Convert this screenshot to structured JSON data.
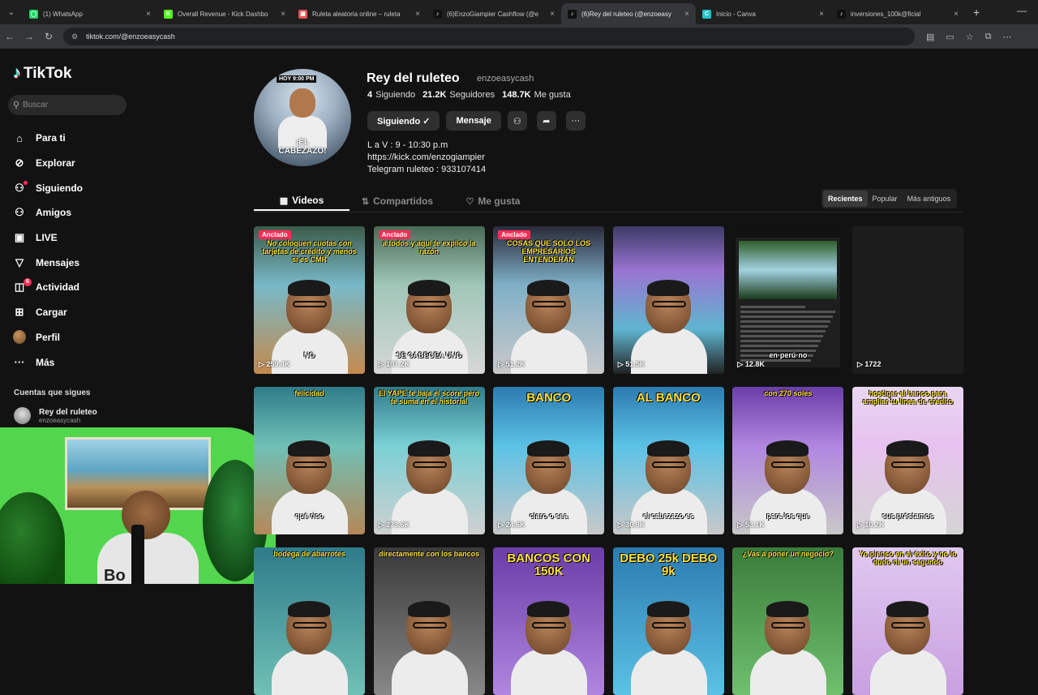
{
  "browser": {
    "tabs": [
      {
        "title": "(1) WhatsApp",
        "fav_color": "#25d366",
        "fav_glyph": "◯"
      },
      {
        "title": "Overall Revenue - Kick Dashbo",
        "fav_color": "#53fc18",
        "fav_glyph": "K"
      },
      {
        "title": "Ruleta aleatoria online – ruleta",
        "fav_color": "#e94f4f",
        "fav_glyph": "▦"
      },
      {
        "title": "(6)EnzoGiampier Cashflow (@e",
        "fav_color": "#111111",
        "fav_glyph": "♪"
      },
      {
        "title": "(6)Rey del ruleteo (@enzoeasy",
        "fav_color": "#111111",
        "fav_glyph": "♪",
        "active": true
      },
      {
        "title": "Inicio - Canva",
        "fav_color": "#20c4cb",
        "fav_glyph": "C"
      },
      {
        "title": "inversiones_100k@ficial",
        "fav_color": "#111111",
        "fav_glyph": "♪"
      }
    ],
    "url": "tiktok.com/@enzoeasycash"
  },
  "sidebar": {
    "logo": "TikTok",
    "search_placeholder": "Buscar",
    "items": [
      {
        "label": "Para ti",
        "icon": "home-icon",
        "glyph": "⌂"
      },
      {
        "label": "Explorar",
        "icon": "compass-icon",
        "glyph": "⊘"
      },
      {
        "label": "Siguiendo",
        "icon": "following-icon",
        "glyph": "⚇"
      },
      {
        "label": "Amigos",
        "icon": "friends-icon",
        "glyph": "⚇"
      },
      {
        "label": "LIVE",
        "icon": "live-icon",
        "glyph": "▣"
      },
      {
        "label": "Mensajes",
        "icon": "messages-icon",
        "glyph": "▽"
      },
      {
        "label": "Actividad",
        "icon": "activity-icon",
        "glyph": "◫",
        "badge": "6"
      },
      {
        "label": "Cargar",
        "icon": "upload-icon",
        "glyph": "⊞"
      },
      {
        "label": "Perfil",
        "icon": "profile-avatar-icon",
        "glyph": ""
      },
      {
        "label": "Más",
        "icon": "more-icon",
        "glyph": "···"
      }
    ],
    "following_title": "Cuentas que sigues",
    "following": [
      {
        "name": "Rey del ruleteo",
        "handle": "enzoeasycash"
      }
    ]
  },
  "profile": {
    "avatar_top": "HOY 9:00 PM",
    "avatar_caption": "¡EL CABEZAZO!",
    "name": "Rey del ruleteo",
    "handle": "enzoeasycash",
    "stats": [
      {
        "value": "4",
        "label": "Siguiendo"
      },
      {
        "value": "21.2K",
        "label": "Seguidores"
      },
      {
        "value": "148.7K",
        "label": "Me gusta"
      }
    ],
    "buttons": {
      "following": "Siguiendo ✓",
      "message": "Mensaje"
    },
    "bio": [
      "L a V : 9 - 10:30 p.m",
      "https://kick.com/enzogiampier",
      "Telegram ruleteo : 933107414"
    ]
  },
  "tabs": [
    {
      "label": "Videos",
      "icon": "▦",
      "active": true
    },
    {
      "label": "Compartidos",
      "icon": "⇅"
    },
    {
      "label": "Me gusta",
      "icon": "♡"
    }
  ],
  "sort": [
    "Recientes",
    "Popular",
    "Más antiguos"
  ],
  "webcam_watermark": "Bo",
  "videos": [
    {
      "views": "259.4K",
      "pinned": "Anclado",
      "caption": "No coloquen cuotas con tarjetas de crédito y menos si es CMR",
      "cap_color": "yellow",
      "sub": "NO",
      "bg": "linear-gradient(180deg,#3b5b4a,#78b9c8 40%,#c48a4d 100%)"
    },
    {
      "views": "107.2K",
      "pinned": "Anclado",
      "caption": "a todos y aquí te explico la razón",
      "cap_color": "yellow",
      "sub": "SE CABECEA UNO",
      "bg": "linear-gradient(180deg,#4a6a55,#9fc7b8 40%,#d7d7d7 100%)"
    },
    {
      "views": "51.2K",
      "pinned": "Anclado",
      "caption": "COSAS QUE SOLO LOS EMPRESARIOS ENTENDERÁN",
      "cap_color": "yellow",
      "sub": "",
      "bg": "linear-gradient(180deg,#2a2a3a,#7fb0c8 40%,#c9c9c9 100%)"
    },
    {
      "views": "51.5K",
      "pinned": "",
      "caption": "",
      "cap_color": "yellow",
      "sub": "",
      "bg": "linear-gradient(180deg,#3b3b66,#9a74d1 30%,#5fb5d0 70%,#222 100%)"
    },
    {
      "views": "12.8K",
      "pinned": "",
      "caption": "",
      "cap_color": "yellow",
      "sub": "en·perú·no",
      "bg": "#111",
      "doc": true
    },
    {
      "views": "1722",
      "pinned": "",
      "caption": "",
      "cap_color": "yellow",
      "sub": "",
      "bg": "#1c1c1c",
      "empty": true
    },
    {
      "views": "",
      "pinned": "",
      "caption": "felicidad",
      "cap_color": "yellow",
      "sub": "qué rico",
      "bg": "linear-gradient(180deg,#2f7c8a,#6fc0b5 40%,#b58858 100%)"
    },
    {
      "views": "273.6K",
      "pinned": "",
      "caption": "El YAPE te baja el score pero te suma en el historial",
      "cap_color": "yellow",
      "sub": "",
      "bg": "linear-gradient(180deg,#2f7c8a,#7ad0d5 40%,#d0d0d0 100%)"
    },
    {
      "views": "24.6K",
      "pinned": "",
      "caption": "BANCO",
      "cap_color": "yellow",
      "sub": "claro o sea",
      "bg": "linear-gradient(180deg,#2c7bb0,#5bc2e5 40%,#c8c8c8 100%)",
      "big": true
    },
    {
      "views": "30.9K",
      "pinned": "",
      "caption": "AL BANCO",
      "cap_color": "yellow",
      "sub": "el cabezazo es",
      "bg": "linear-gradient(180deg,#2c7bb0,#5bc2e5 40%,#c8c8c8 100%)",
      "big": true
    },
    {
      "views": "53.1K",
      "pinned": "",
      "caption": "con 270 soles",
      "cap_color": "yellow",
      "sub": "para los que",
      "bg": "linear-gradient(180deg,#6a3da8,#b086e0 40%,#c8c8c8 100%)"
    },
    {
      "views": "10.2K",
      "pinned": "",
      "caption": "hostigar al banco para ampliar tu línea de crédito",
      "cap_color": "yellow",
      "sub": "sus préstamos",
      "bg": "linear-gradient(180deg,#e8d7f0,#e7c2f0 40%,#d4d4d4 100%)"
    },
    {
      "views": "",
      "pinned": "",
      "caption": "bodega de abarrotes",
      "cap_color": "yellow",
      "sub": "",
      "bg": "linear-gradient(180deg,#2f7c8a,#6fc0b5)"
    },
    {
      "views": "",
      "pinned": "",
      "caption": "directamente con los bancos",
      "cap_color": "yellow",
      "sub": "",
      "bg": "linear-gradient(180deg,#3a3a3a,#888)"
    },
    {
      "views": "",
      "pinned": "",
      "caption": "BANCOS CON 150K",
      "cap_color": "yellow",
      "sub": "",
      "bg": "linear-gradient(180deg,#6a3da8,#b086e0)",
      "big": true
    },
    {
      "views": "",
      "pinned": "",
      "caption": "DEBO 25k   DEBO 9k",
      "cap_color": "yellow",
      "sub": "",
      "bg": "linear-gradient(180deg,#2c7bb0,#5bc2e5)",
      "big": true
    },
    {
      "views": "",
      "pinned": "",
      "caption": "¿Vas a poner un negocio?",
      "cap_color": "yellow",
      "sub": "",
      "bg": "linear-gradient(180deg,#3a7c3a,#6fc06f)"
    },
    {
      "views": "",
      "pinned": "",
      "caption": "Yo pienso en el éxito y no lo dudo ni un segundo",
      "cap_color": "yellow",
      "sub": "",
      "bg": "linear-gradient(180deg,#e0c8f0,#c8a0e0)"
    }
  ]
}
